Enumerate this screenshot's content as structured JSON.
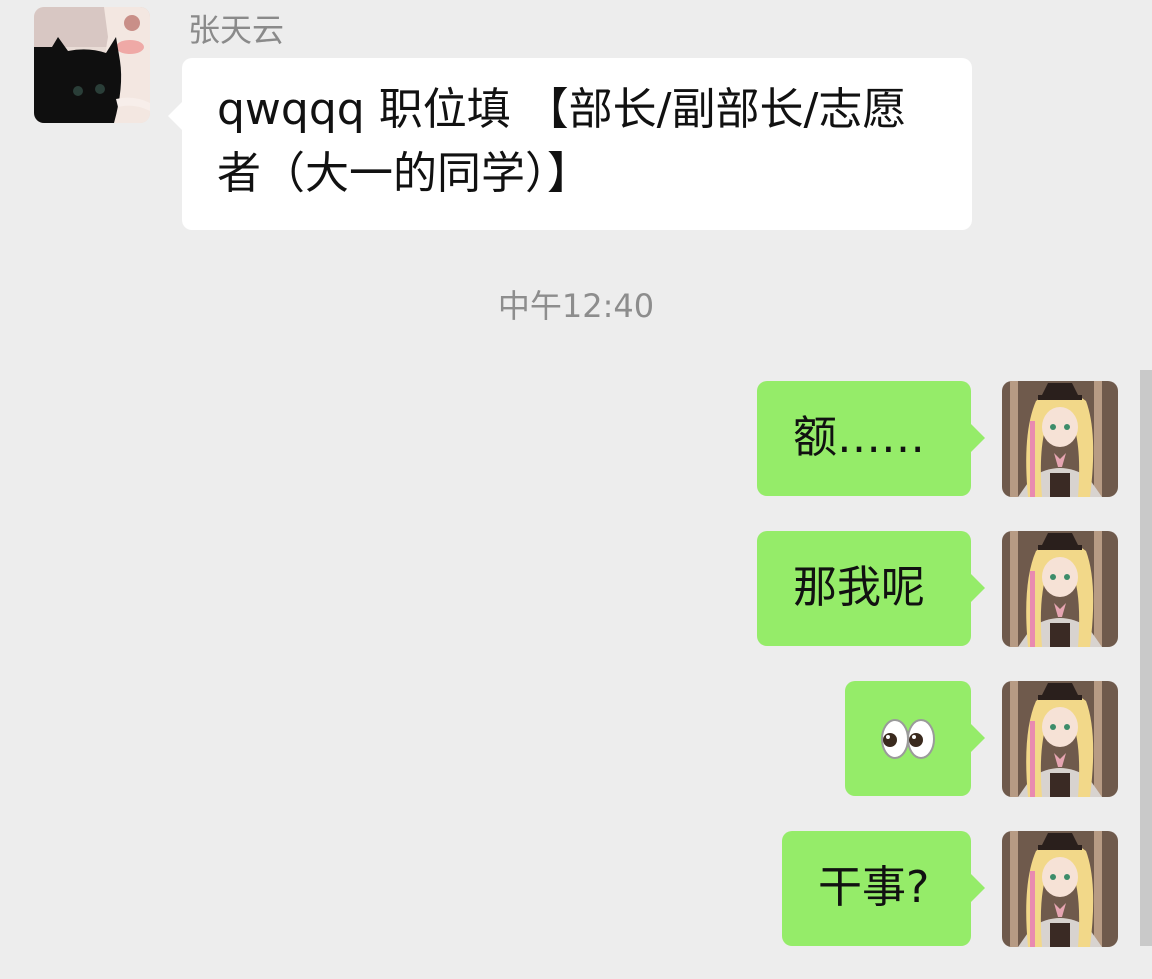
{
  "incoming_message": {
    "sender": "张天云",
    "text": "qwqqq 职位填 【部长/副部长/志愿者（大一的同学）】",
    "avatar_icon": "black-cat-avatar"
  },
  "timestamp": "中午12:40",
  "outgoing_messages": [
    {
      "text": "额……"
    },
    {
      "text": "那我呢"
    },
    {
      "text": "👀"
    },
    {
      "text": "干事?"
    }
  ],
  "self_avatar_icon": "anime-girl-avatar",
  "colors": {
    "background": "#ededed",
    "incoming_bubble": "#ffffff",
    "outgoing_bubble": "#95ec69",
    "meta_text": "#8a8a8a"
  }
}
